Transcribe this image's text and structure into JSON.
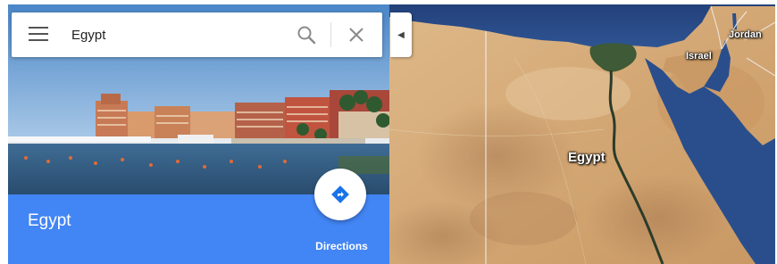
{
  "search": {
    "value": "Egypt",
    "menu_icon": "hamburger-menu-icon",
    "search_icon": "search-icon",
    "clear_icon": "close-icon"
  },
  "panel": {
    "title": "Egypt",
    "directions_label": "Directions",
    "directions_icon": "directions-icon",
    "header_color": "#4285f4"
  },
  "map": {
    "labels": {
      "country": "Egypt",
      "jordan": "Jordan",
      "israel": "Israel"
    },
    "collapse_icon": "chevron-left-icon"
  }
}
